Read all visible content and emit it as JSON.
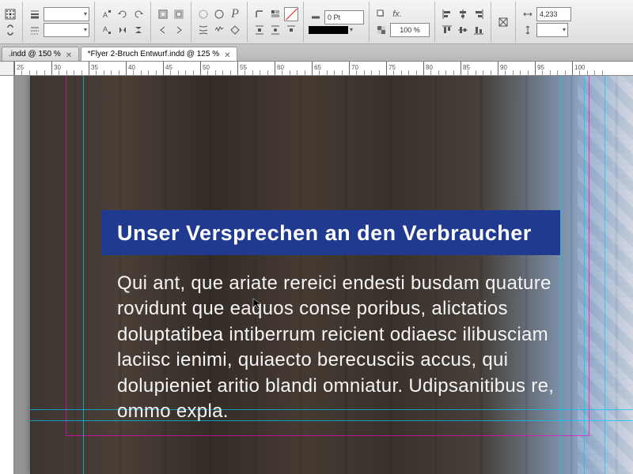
{
  "toolbar": {
    "stroke_weight": "0 Pt",
    "zoom": "100 %",
    "width_field": "4,233"
  },
  "tabs": [
    {
      "label": ".indd @ 150 %",
      "active": false
    },
    {
      "label": "*Flyer 2-Bruch Entwurf.indd @ 125 %",
      "active": true
    }
  ],
  "ruler_marks": [
    25,
    30,
    35,
    40,
    45,
    50,
    55,
    60,
    65,
    70,
    75,
    80,
    85,
    90,
    95,
    100
  ],
  "content": {
    "heading": "Unser Versprechen an den Verbraucher",
    "body": "Qui ant, que ariate rereici endesti busdam quature rovidunt que eaquos conse poribus, alictatios dolup­tatibea intiberrum reicient odiaesc ilibusciam laciisc ienimi, quiaecto berecusciis accus, qui dolupieniet aritio blandi omniatur. Udipsanitibus re, ommo expla."
  },
  "icons": {
    "circle_char": "○",
    "effects": "fx."
  }
}
